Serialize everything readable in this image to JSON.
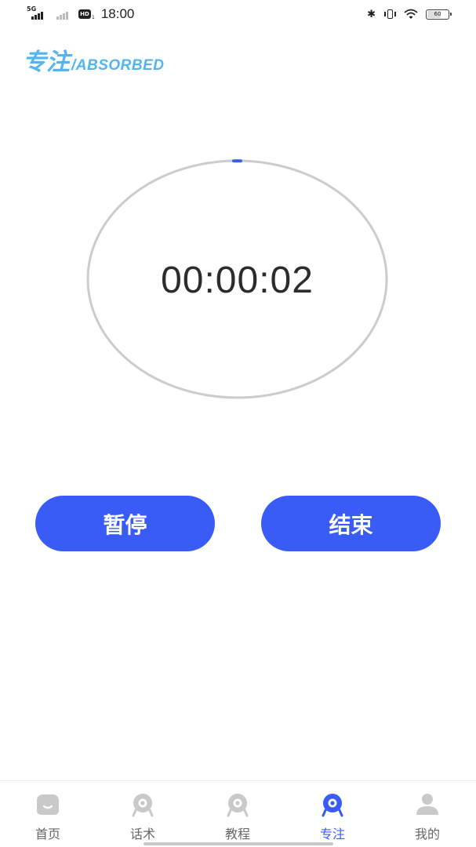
{
  "status_bar": {
    "network_tag": "5G",
    "hd_label": "HD",
    "hd_sub": "1",
    "time": "18:00",
    "battery_level": "60",
    "icons": [
      "signal-icon",
      "hd-icon",
      "bluetooth-icon",
      "vibrate-icon",
      "wifi-icon",
      "battery-icon"
    ]
  },
  "header": {
    "title_zh": "专注",
    "title_en": "/ABSORBED",
    "accent_color": "#52b4f0"
  },
  "timer": {
    "display": "00:00:02",
    "ring_color": "#cccccc",
    "progress_color": "#3a5cf6"
  },
  "actions": {
    "pause_label": "暂停",
    "end_label": "结束",
    "button_color": "#3a5cf6"
  },
  "tabbar": {
    "active_color": "#3a5cf6",
    "inactive_color": "#c9c9c9",
    "items": [
      {
        "label": "首页",
        "icon": "home-icon",
        "active": false
      },
      {
        "label": "话术",
        "icon": "script-icon",
        "active": false
      },
      {
        "label": "教程",
        "icon": "tutorial-icon",
        "active": false
      },
      {
        "label": "专注",
        "icon": "focus-icon",
        "active": true
      },
      {
        "label": "我的",
        "icon": "profile-icon",
        "active": false
      }
    ]
  }
}
